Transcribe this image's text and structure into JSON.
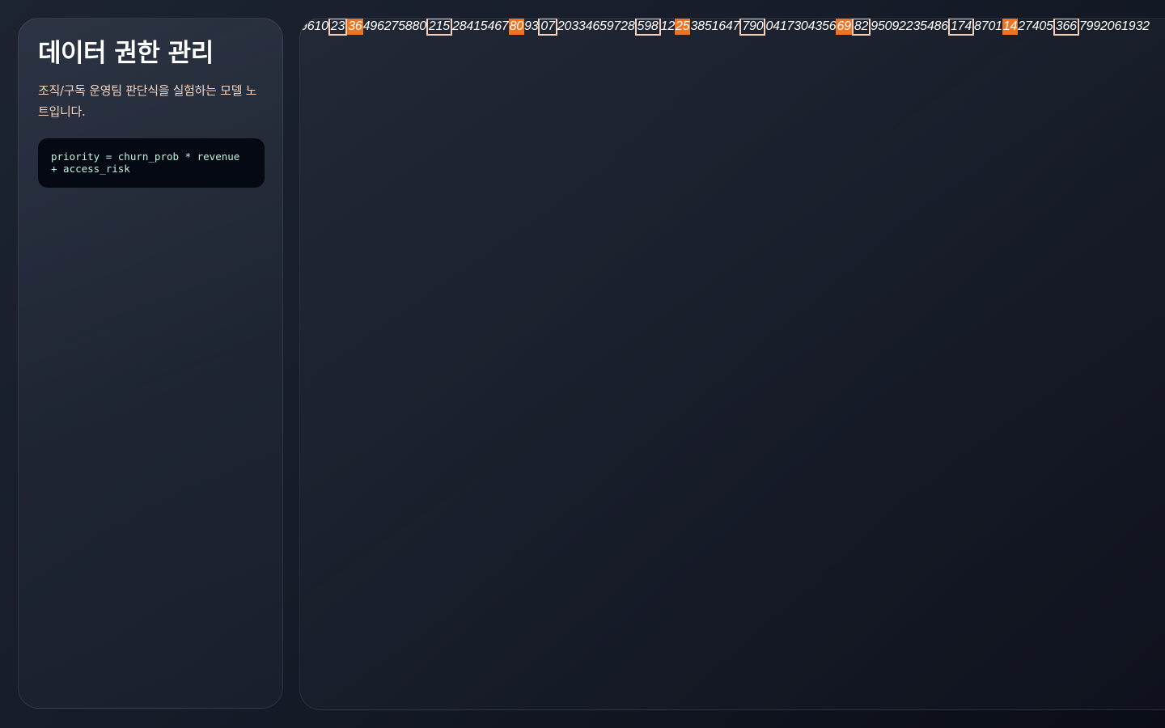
{
  "sidebar": {
    "title": "데이터 권한 관리",
    "description": "조직/구독 운영팀 판단식을 실험하는 모델 노트입니다.",
    "formula": "priority = churn_prob * revenue + access_risk"
  },
  "stream": {
    "segments": [
      {
        "text": "9610",
        "style": "plain"
      },
      {
        "text": "23",
        "style": "boxed"
      },
      {
        "text": "36",
        "style": "highlight"
      },
      {
        "text": "496275880",
        "style": "plain"
      },
      {
        "text": "215",
        "style": "boxed"
      },
      {
        "text": "28415467",
        "style": "plain"
      },
      {
        "text": "80",
        "style": "highlight"
      },
      {
        "text": "93",
        "style": "plain"
      },
      {
        "text": "07",
        "style": "boxed"
      },
      {
        "text": "20334659728",
        "style": "plain"
      },
      {
        "text": "598",
        "style": "boxed"
      },
      {
        "text": "12",
        "style": "plain"
      },
      {
        "text": "25",
        "style": "highlight"
      },
      {
        "text": "3851647",
        "style": "plain"
      },
      {
        "text": "790",
        "style": "boxed"
      },
      {
        "text": "0417304356",
        "style": "plain"
      },
      {
        "text": "69",
        "style": "highlight"
      },
      {
        "text": "82",
        "style": "boxed"
      },
      {
        "text": "95092235486",
        "style": "plain"
      },
      {
        "text": "174",
        "style": "boxed"
      },
      {
        "text": "8701",
        "style": "plain"
      },
      {
        "text": "14",
        "style": "highlight"
      },
      {
        "text": "27405",
        "style": "plain"
      },
      {
        "text": "366",
        "style": "boxed"
      },
      {
        "text": "7992061932",
        "style": "plain"
      }
    ]
  },
  "colors": {
    "highlight": "#ef7422",
    "box_border": "#f6d2bc",
    "description_text": "#f6d3bf",
    "code_text": "#bff5dd",
    "code_background": "#050914"
  }
}
